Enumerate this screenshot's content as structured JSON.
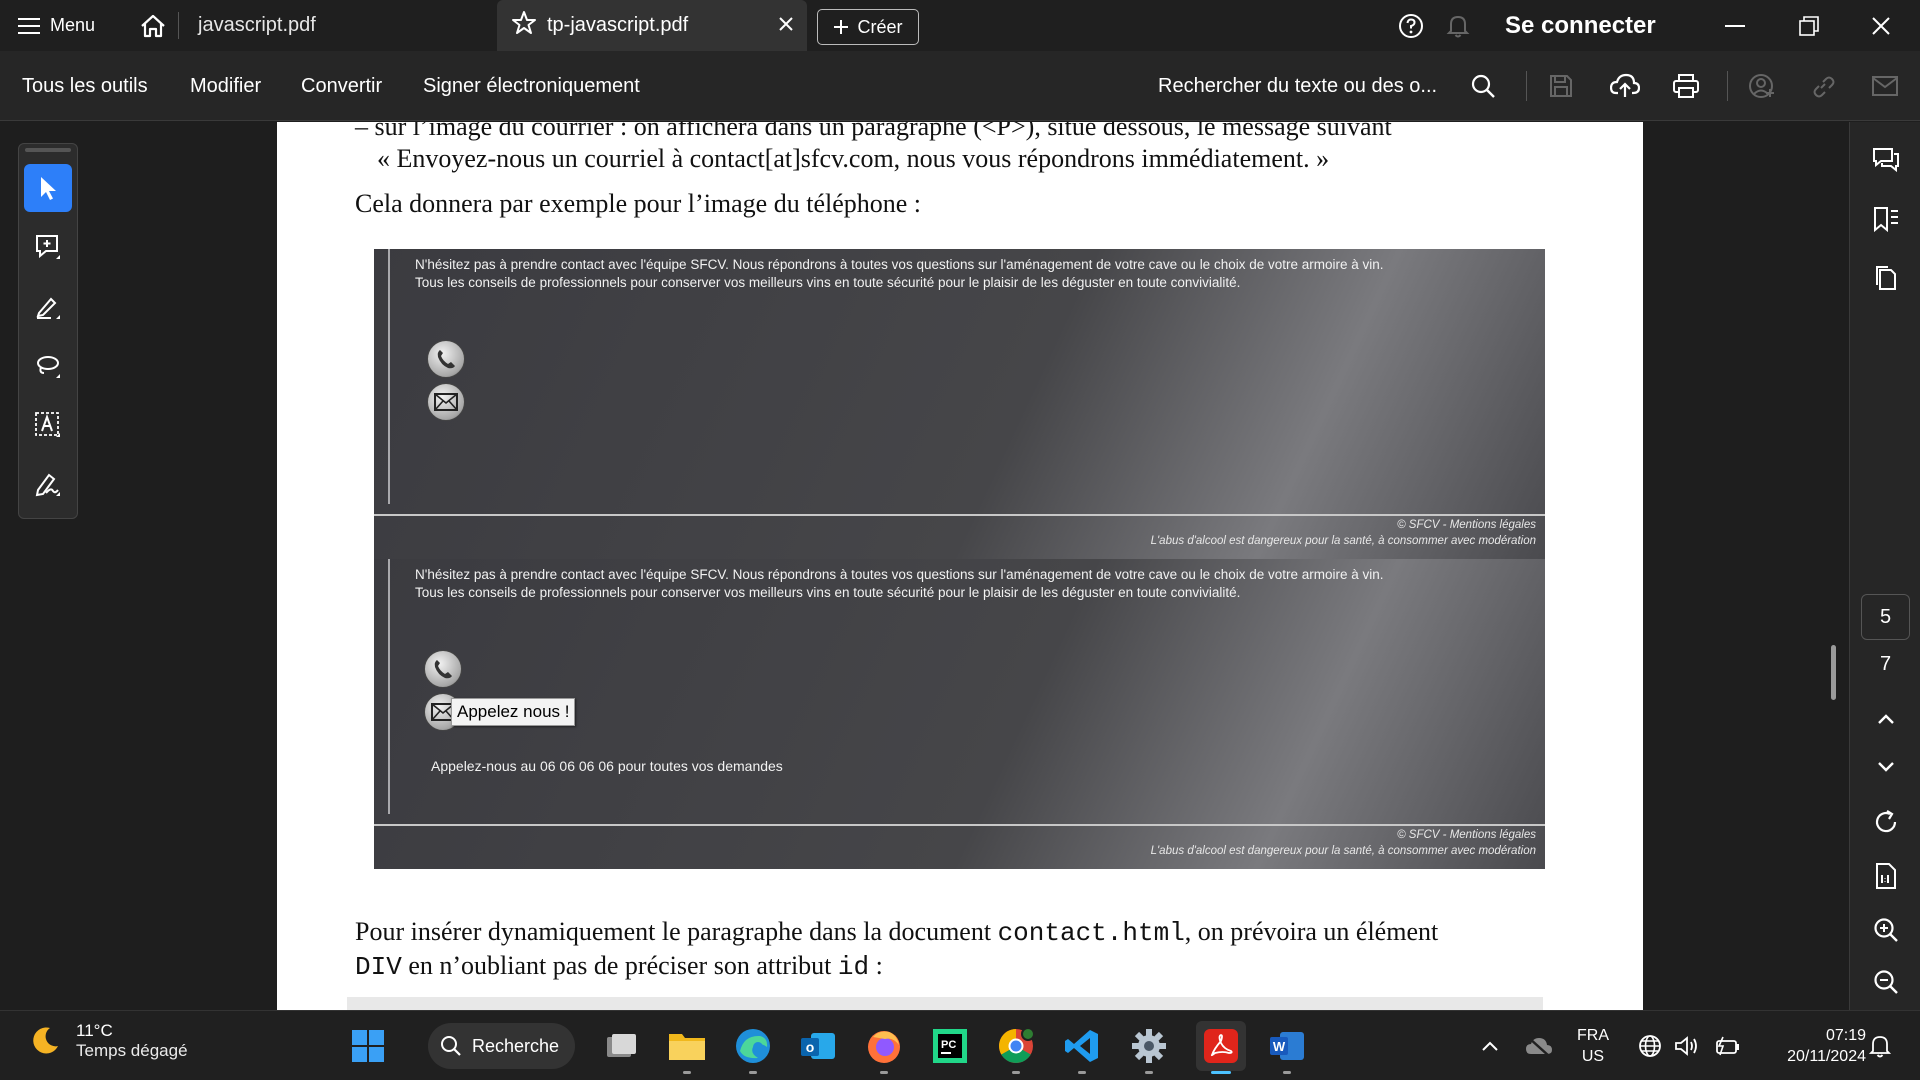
{
  "tabbar": {
    "menu_label": "Menu",
    "tabs": [
      {
        "label": "javascript.pdf"
      },
      {
        "label": "tp-javascript.pdf"
      }
    ],
    "create_label": "Créer",
    "signin_label": "Se connecter"
  },
  "toolbar": {
    "all_tools": "Tous les outils",
    "edit": "Modifier",
    "convert": "Convertir",
    "sign": "Signer électroniquement",
    "search_placeholder": "Rechercher du texte ou des o..."
  },
  "document": {
    "line1": "– sur l’image du courrier : on affichera dans un paragraphe (<P>), situé dessous, le message suivant",
    "line2": "« Envoyez-nous un courriel à contact[at]sfcv.com, nous vous répondrons immédiatement. »",
    "line3": "Cela donnera par exemple pour l’image du téléphone :",
    "screenshot_text": "N'hésitez pas à prendre contact avec l'équipe SFCV. Nous répondrons à toutes vos questions sur l'aménagement de votre cave ou le choix de votre armoire à vin. Tous les conseils de professionnels pour conserver vos meilleurs vins en toute sécurité pour le plaisir de les déguster en toute convivialité.",
    "footer_line1": "© SFCV - Mentions légales",
    "footer_line2": "L'abus d'alcool est dangereux pour la santé, à consommer avec modération",
    "tooltip": "Appelez nous !",
    "phone_message": "Appelez-nous au 06 06 06 06 pour toutes vos demandes",
    "para_part1": "Pour insérer dynamiquement le paragraphe dans la document ",
    "para_code1": "contact.html",
    "para_part2": ", on prévoira un élément",
    "para2_code": "DIV",
    "para2_part": " en n’oubliant pas de préciser son attribut ",
    "para2_code2": "id",
    "para2_end": " :"
  },
  "rightbar": {
    "page_current": "5",
    "page_total": "7"
  },
  "taskbar": {
    "temperature": "11°C",
    "weather": "Temps dégagé",
    "search_label": "Recherche",
    "lang1": "FRA",
    "lang2": "US",
    "time": "07:19",
    "date": "20/11/2024"
  },
  "colors": {
    "accent": "#2d7ff9",
    "acrobat_red": "#e0251b"
  }
}
